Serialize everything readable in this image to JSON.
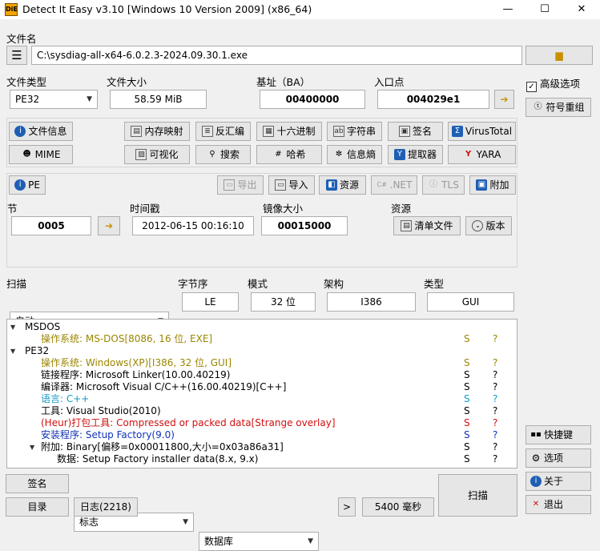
{
  "window": {
    "title": "Detect It Easy v3.10 [Windows 10 Version 2009] (x86_64)",
    "minimize": "—",
    "maximize": "☐",
    "close": "✕",
    "app_icon": "DiE"
  },
  "file": {
    "label": "文件名",
    "path": "C:\\sysdiag-all-x64-6.0.2.3-2024.09.30.1.exe"
  },
  "info": {
    "file_type_label": "文件类型",
    "file_type_value": "PE32",
    "file_size_label": "文件大小",
    "file_size_value": "58.59 MiB",
    "base_label": "基址（BA）",
    "base_value": "00400000",
    "entry_label": "入口点",
    "entry_value": "004029e1"
  },
  "right_panel": {
    "advanced_label": "高级选项",
    "advanced_checked": true,
    "symbol_reorg": "符号重组",
    "shortcuts": "快捷键",
    "options": "选项",
    "about": "关于",
    "exit": "退出"
  },
  "tools": {
    "file_info": "文件信息",
    "memory_map": "内存映射",
    "disasm": "反汇编",
    "hex": "十六进制",
    "strings": "字符串",
    "signatures": "签名",
    "virustotal": "VirusTotal",
    "mime": "MIME",
    "visualize": "可视化",
    "search": "搜索",
    "hash": "哈希",
    "entropy": "信息熵",
    "extractor": "提取器",
    "yara": "YARA"
  },
  "pe": {
    "pe_button": "PE",
    "export": "导出",
    "import": "导入",
    "resources": "资源",
    "dotnet": ".NET",
    "tls": "TLS",
    "overlay": "附加",
    "section_label": "节",
    "section_value": "0005",
    "timestamp_label": "时间戳",
    "timestamp_value": "2012-06-15 00:16:10",
    "image_size_label": "镜像大小",
    "image_size_value": "00015000",
    "resources_label": "资源",
    "manifest": "清单文件",
    "version": "版本"
  },
  "scan": {
    "scan_label": "扫描",
    "scan_mode": "自动",
    "endian_label": "字节序",
    "endian_value": "LE",
    "mode_label": "模式",
    "mode_value": "32 位",
    "arch_label": "架构",
    "arch_value": "I386",
    "type_label": "类型",
    "type_value": "GUI"
  },
  "results": [
    {
      "text": "MSDOS",
      "color": "#000000",
      "expander": "▼",
      "s": "",
      "q": ""
    },
    {
      "text": "操作系统: MS-DOS[8086, 16 位, EXE]",
      "color": "#9b8600",
      "s": "S",
      "q": "?"
    },
    {
      "text": "PE32",
      "color": "#000000",
      "expander": "▼",
      "s": "",
      "q": ""
    },
    {
      "text": "操作系统: Windows(XP)[I386, 32 位, GUI]",
      "color": "#9b8600",
      "s": "S",
      "q": "?"
    },
    {
      "text": "链接程序: Microsoft Linker(10.00.40219)",
      "color": "#000000",
      "s": "S",
      "q": "?"
    },
    {
      "text": "编译器: Microsoft Visual C/C++(16.00.40219)[C++]",
      "color": "#000000",
      "s": "S",
      "q": "?"
    },
    {
      "text": "语言: C++",
      "color": "#139bc8",
      "s": "S",
      "q": "?"
    },
    {
      "text": "工具: Visual Studio(2010)",
      "color": "#000000",
      "s": "S",
      "q": "?"
    },
    {
      "text": "(Heur)打包工具: Compressed or packed data[Strange overlay]",
      "color": "#d01010",
      "s": "S",
      "q": "?"
    },
    {
      "text": "安装程序: Setup Factory(9.0)",
      "color": "#1133b8",
      "s": "S",
      "q": "?"
    },
    {
      "text": "附加: Binary[偏移=0x00011800,大小=0x03a86a31]",
      "color": "#000000",
      "expander": "▼",
      "s": "S",
      "q": "?"
    },
    {
      "text": "数据: Setup Factory installer data(8.x, 9.x)",
      "color": "#000000",
      "s": "S",
      "q": "?"
    }
  ],
  "bottom": {
    "signatures": "签名",
    "flags": "标志",
    "database": "数据库",
    "directory": "目录",
    "log": "日志(2218)",
    "more": ">",
    "elapsed": "5400 毫秒",
    "scan": "扫描"
  }
}
